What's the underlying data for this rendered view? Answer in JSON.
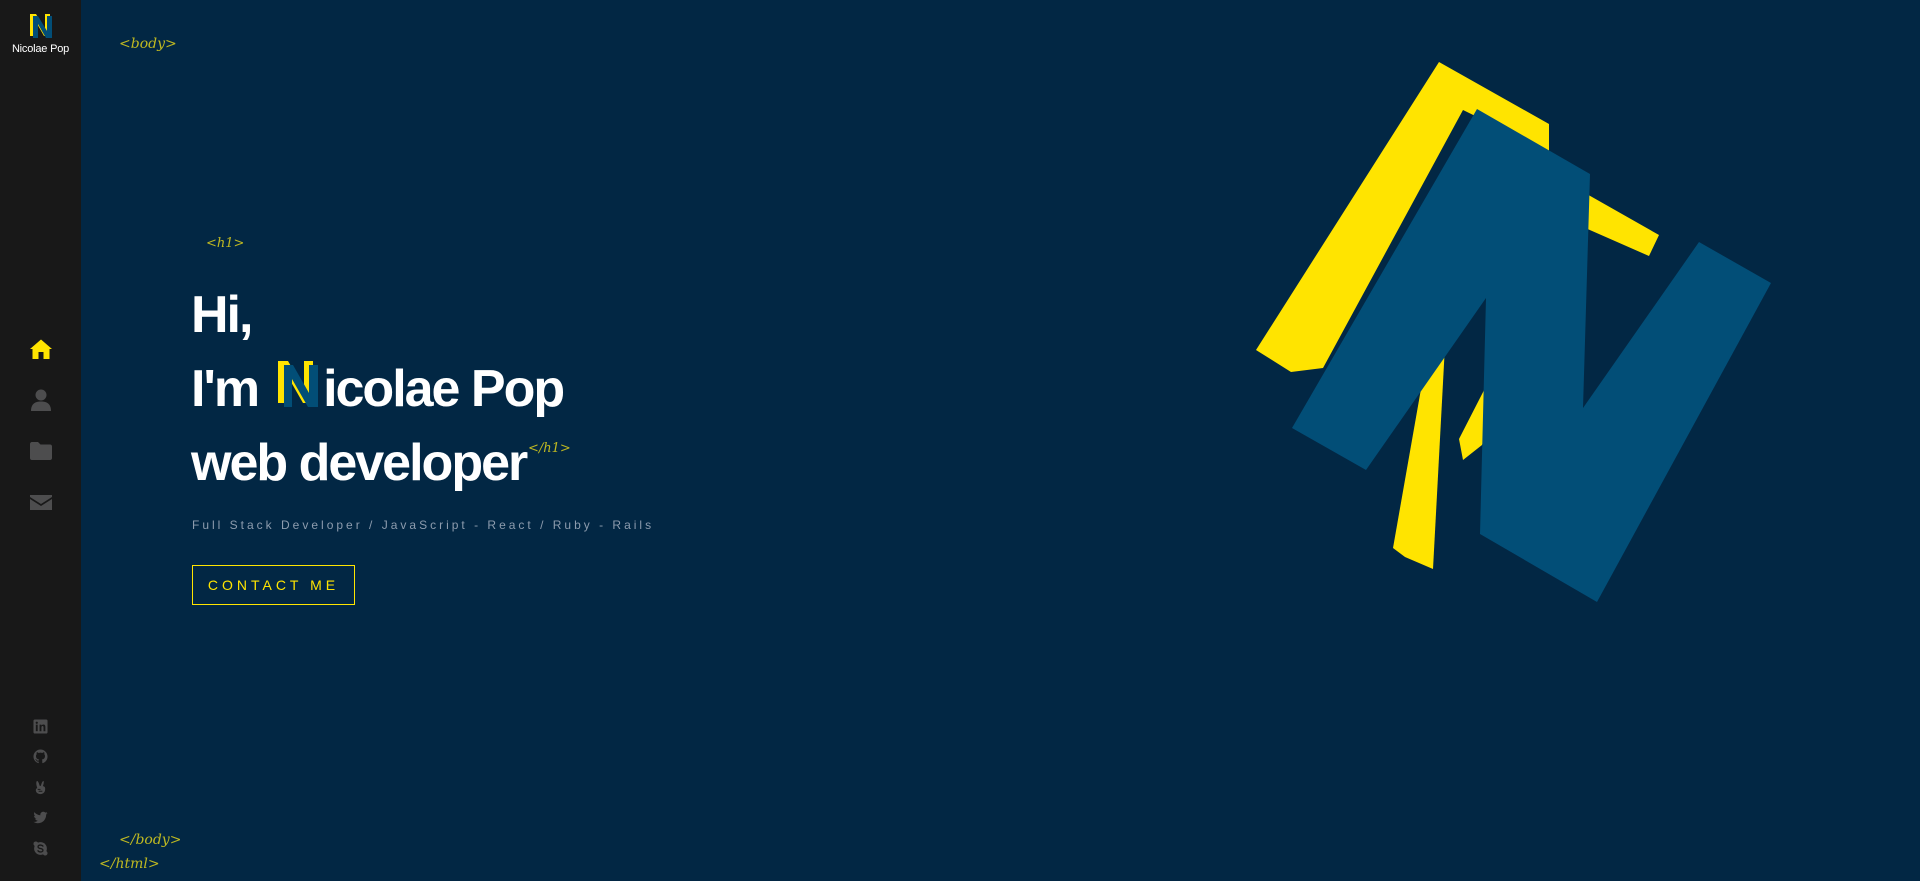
{
  "brand": {
    "name": "Nicolae Pop",
    "logo_icon": "n-logo-icon"
  },
  "nav": {
    "items": [
      {
        "name": "home",
        "icon": "home-icon",
        "active": true
      },
      {
        "name": "about",
        "icon": "user-icon",
        "active": false
      },
      {
        "name": "portfolio",
        "icon": "folder-icon",
        "active": false
      },
      {
        "name": "contact",
        "icon": "envelope-icon",
        "active": false
      }
    ]
  },
  "social": {
    "items": [
      {
        "name": "linkedin",
        "icon": "linkedin-icon"
      },
      {
        "name": "github",
        "icon": "github-icon"
      },
      {
        "name": "angellist",
        "icon": "angellist-icon"
      },
      {
        "name": "twitter",
        "icon": "twitter-icon"
      },
      {
        "name": "skype",
        "icon": "skype-icon"
      }
    ]
  },
  "tags": {
    "body_open": "<body>",
    "h1_open": "<h1>",
    "h1_close": "</h1>",
    "body_close": "</body>",
    "html_close": "</html>"
  },
  "hero": {
    "line1": "Hi,",
    "line2_prefix": "I'm",
    "line2_name": "icolae Pop",
    "line3": "web developer"
  },
  "subtitle": "Full Stack Developer / JavaScript - React / Ruby - Rails",
  "contact_button": "CONTACT ME",
  "colors": {
    "background": "#022744",
    "sidebar": "#181818",
    "accent": "#ffe400",
    "logo_blue": "#024e77",
    "text": "#ffffff",
    "muted": "#8d9cae",
    "icon_inactive": "#4d4d4e"
  }
}
